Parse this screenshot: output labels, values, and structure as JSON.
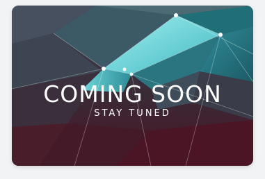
{
  "card": {
    "headline": "COMING SOON",
    "subline": "STAY TUNED"
  },
  "colors": {
    "page_background": "#f2f3f4",
    "teal_light": "#8fe3e6",
    "teal": "#3fb6bf",
    "teal_dark": "#1f6e78",
    "wine": "#4a1424",
    "slate": "#3a3f4c",
    "text": "#ffffff"
  }
}
